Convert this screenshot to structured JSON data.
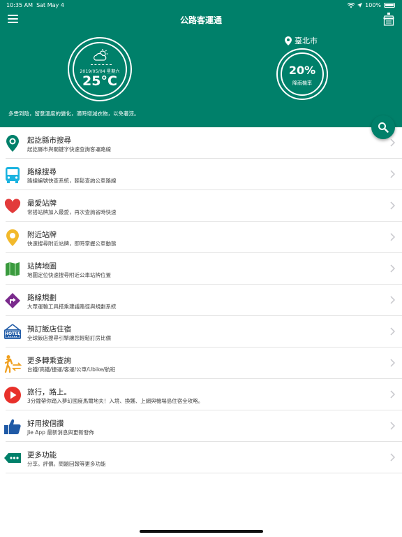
{
  "status_bar": {
    "time": "10:35 AM",
    "date": "Sat May 4",
    "battery": "100%"
  },
  "header": {
    "title": "公路客運通"
  },
  "weather": {
    "date": "2019/05/04 星期六",
    "temperature": "25°C"
  },
  "location": {
    "city": "臺北市"
  },
  "rain": {
    "value": "20%",
    "label": "降雨機率"
  },
  "tip": "多雲到陰，留意溫度的變化，適時增減衣物，以免著涼。",
  "menu": [
    {
      "title": "起訖縣市搜尋",
      "subtitle": "起訖縣市與關鍵字快速查詢客運路線",
      "icon": "map-pin-icon"
    },
    {
      "title": "路線搜尋",
      "subtitle": "路線編號快查系統，輕鬆查詢公車路線",
      "icon": "bus-icon"
    },
    {
      "title": "最愛站牌",
      "subtitle": "常搭站牌加入最愛，再次查詢省時快速",
      "icon": "heart-icon"
    },
    {
      "title": "附近站牌",
      "subtitle": "快速搜尋附近站牌，即時掌握公車動態",
      "icon": "nearby-pin-icon"
    },
    {
      "title": "站牌地圖",
      "subtitle": "地圖定位快速搜尋附近公車站牌位置",
      "icon": "map-icon"
    },
    {
      "title": "路線規劃",
      "subtitle": "大眾運輸工具搭乘建議路徑與規劃系統",
      "icon": "route-sign-icon"
    },
    {
      "title": "預訂飯店住宿",
      "subtitle": "全球飯店搜尋引擎讓您輕鬆訂房比價",
      "icon": "hotel-icon"
    },
    {
      "title": "更多轉乘查詢",
      "subtitle": "台鐵/高鐵/捷運/客運/公車/Ubike/航班",
      "icon": "transfer-icon"
    },
    {
      "title": "旅行，路上。",
      "subtitle": "3分鐘帶你踏入夢幻國度馬爾地夫！入境、換鑊、上網與機場島住宿全攻略。",
      "icon": "play-icon"
    },
    {
      "title": "好用按個讚",
      "subtitle": "Jie App 最新消息與更新發佈",
      "icon": "thumbs-up-icon"
    },
    {
      "title": "更多功能",
      "subtitle": "分享。評價。問題回報等更多功能",
      "icon": "more-tag-icon"
    }
  ],
  "colors": {
    "primary": "#00806a"
  }
}
